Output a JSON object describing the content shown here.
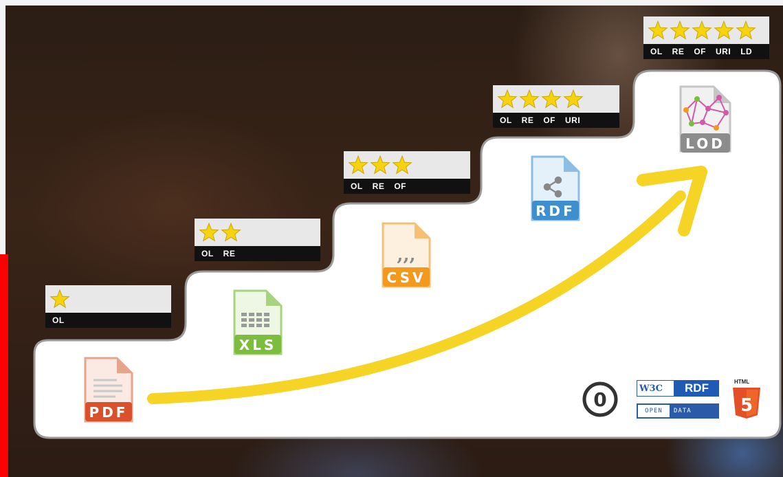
{
  "levels": [
    {
      "stars": 1,
      "labels": [
        "OL"
      ],
      "file": "PDF",
      "color": "#d9502a"
    },
    {
      "stars": 2,
      "labels": [
        "OL",
        "RE"
      ],
      "file": "XLS",
      "color": "#7cbd3e"
    },
    {
      "stars": 3,
      "labels": [
        "OL",
        "RE",
        "OF"
      ],
      "file": "CSV",
      "color": "#f39a1e"
    },
    {
      "stars": 4,
      "labels": [
        "OL",
        "RE",
        "OF",
        "URI"
      ],
      "file": "RDF",
      "color": "#3e8fd0"
    },
    {
      "stars": 5,
      "labels": [
        "OL",
        "RE",
        "OF",
        "URI",
        "LD"
      ],
      "file": "LOD",
      "color": "#8c8c8c"
    }
  ],
  "logos": {
    "cc_zero": "0",
    "w3c": "W3C",
    "rdf": "RDF",
    "open": "OPEN",
    "data": "DATA",
    "html": "HTML",
    "html5_digit": "5"
  },
  "colors": {
    "star": "#f5d311",
    "arrow": "#f6d21a",
    "card": "#ffffff",
    "accent_red": "#ff0000"
  }
}
